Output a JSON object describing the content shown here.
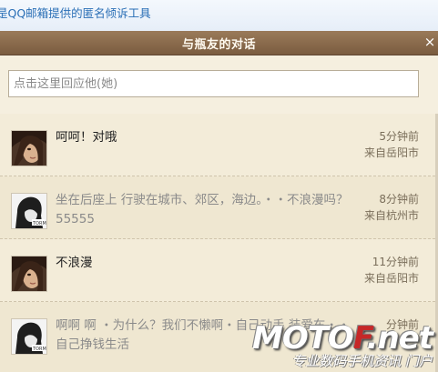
{
  "top_strip": {
    "text": "是QQ邮箱提供的匿名倾诉工具"
  },
  "dialog": {
    "title": "与瓶友的对话",
    "close_glyph": "×"
  },
  "reply": {
    "placeholder": "点击这里回应他(她)"
  },
  "messages": [
    {
      "text": "呵呵！对哦",
      "time": "5分钟前",
      "location": "来自岳阳市",
      "avatar": "girl-avatar"
    },
    {
      "text": "坐在后座上 行驶在城市、郊区，海边。・・不浪漫吗？55555",
      "time": "8分钟前",
      "location": "来自杭州市",
      "avatar": "bw-avatar"
    },
    {
      "text": "不浪漫",
      "time": "11分钟前",
      "location": "来自岳阳市",
      "avatar": "girl-avatar"
    },
    {
      "text": "啊啊 啊 ・为什么？我们不懒啊・自己动手 装爱车・・自己挣钱生活",
      "time": "分钟前",
      "location": "",
      "avatar": "bw-avatar"
    }
  ],
  "watermark": {
    "brand_a": "MOTO",
    "brand_f": "F",
    "brand_b": ".net",
    "tagline": "专业数码手机资讯 门户"
  }
}
